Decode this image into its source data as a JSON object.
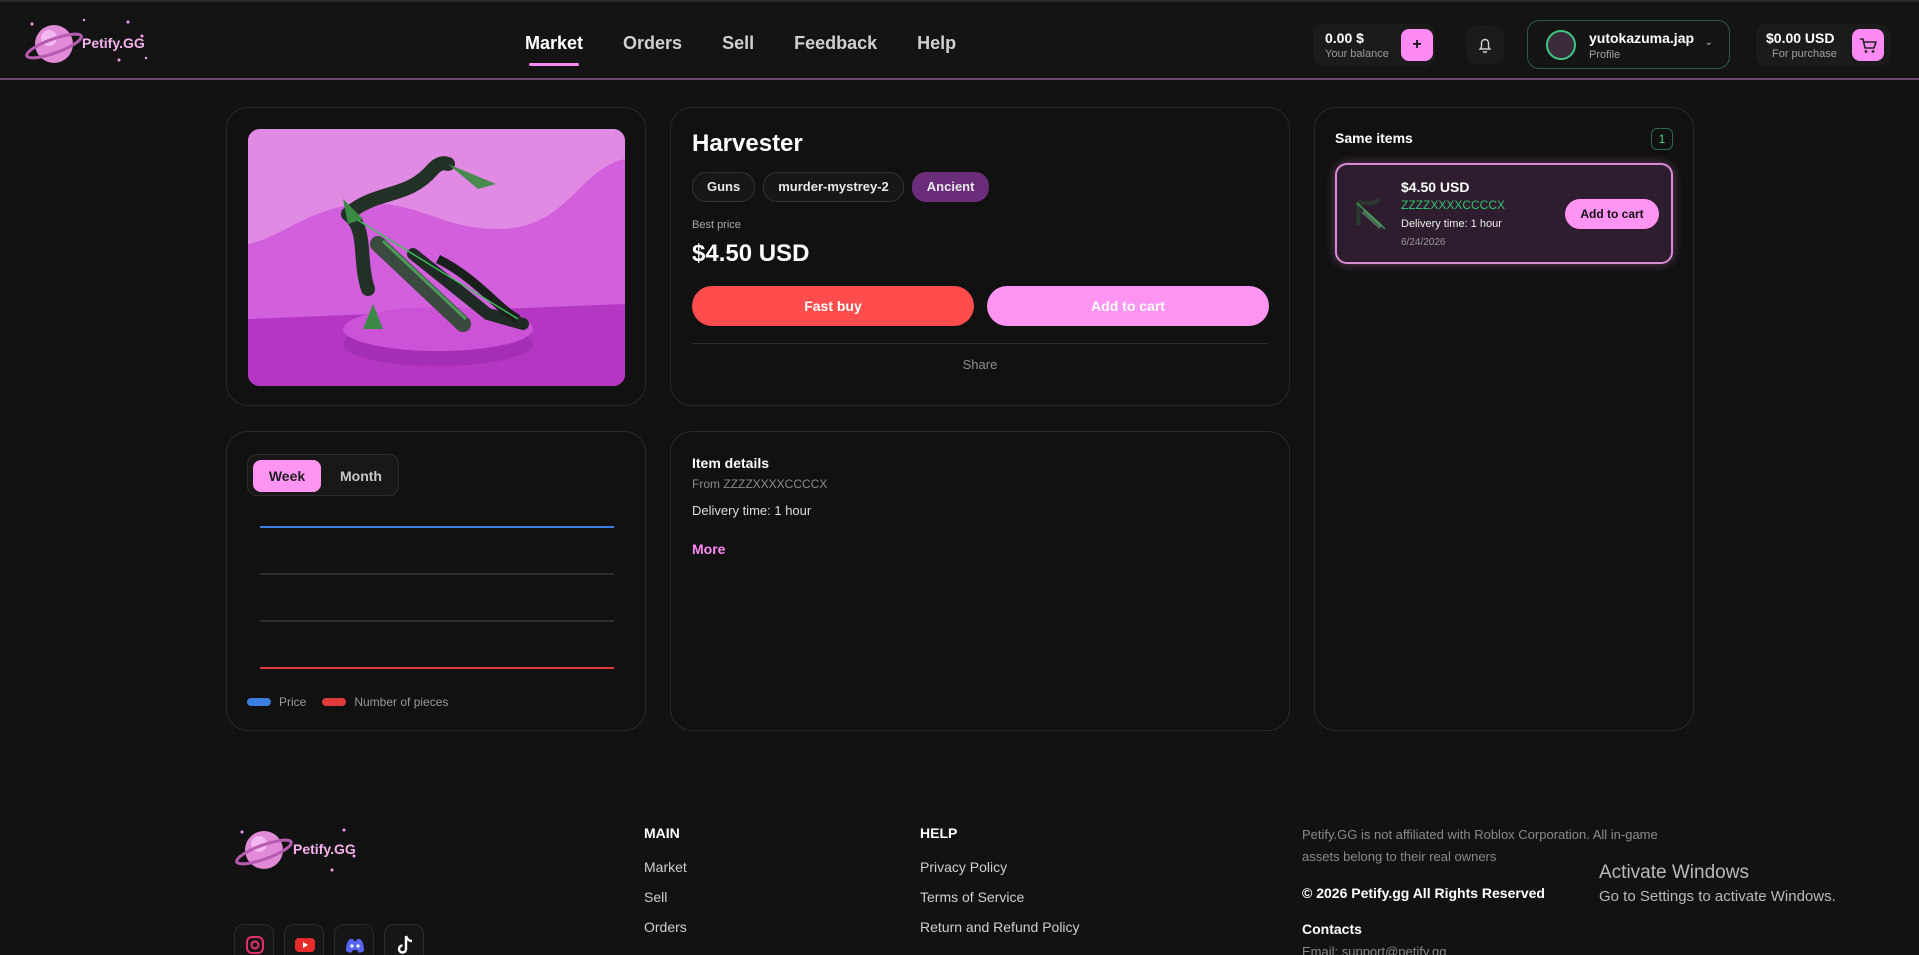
{
  "header": {
    "brand": "Petify.GG",
    "nav": [
      "Market",
      "Orders",
      "Sell",
      "Feedback",
      "Help"
    ],
    "balance": {
      "amount": "0.00 $",
      "label": "Your balance",
      "plus": "+"
    },
    "profile": {
      "name": "yutokazuma.jap",
      "sub": "Profile"
    },
    "cart": {
      "amount": "$0.00 USD",
      "label": "For purchase"
    }
  },
  "item": {
    "title": "Harvester",
    "tags": [
      "Guns",
      "murder-mystrey-2",
      "Ancient"
    ],
    "best_price_label": "Best price",
    "price": "$4.50 USD",
    "fast_buy": "Fast buy",
    "add_to_cart": "Add to cart",
    "share": "Share"
  },
  "same_items": {
    "title": "Same items",
    "count": "1",
    "listing": {
      "price": "$4.50 USD",
      "seller": "ZZZZXXXXCCCCX",
      "delivery": "Delivery time: 1 hour",
      "date": "6/24/2026",
      "button": "Add to cart"
    }
  },
  "chart": {
    "tabs": [
      "Week",
      "Month"
    ],
    "legend": [
      "Price",
      "Number of pieces"
    ],
    "colors": {
      "price": "#3b7de0",
      "pieces": "#e03b3b"
    }
  },
  "details": {
    "title": "Item details",
    "from": "From ZZZZXXXXCCCCX",
    "delivery": "Delivery time: 1 hour",
    "more": "More"
  },
  "footer": {
    "brand": "Petify.GG",
    "main_title": "MAIN",
    "main_links": [
      "Market",
      "Sell",
      "Orders"
    ],
    "help_title": "HELP",
    "help_links": [
      "Privacy Policy",
      "Terms of Service",
      "Return and Refund Policy"
    ],
    "disclaimer": "Petify.GG is not affiliated with Roblox Corporation. All in-game assets belong to their real owners",
    "copyright": "© 2026 Petify.gg All Rights Reserved",
    "contacts_title": "Contacts",
    "email": "Email: support@petify.gg",
    "socials": [
      "instagram-icon",
      "youtube-icon",
      "discord-icon",
      "tiktok-icon"
    ]
  },
  "os_overlay": {
    "line1": "Activate Windows",
    "line2": "Go to Settings to activate Windows."
  },
  "colors": {
    "accent": "#ff8af3",
    "danger": "#ff4d4d",
    "success": "#33c46f"
  }
}
